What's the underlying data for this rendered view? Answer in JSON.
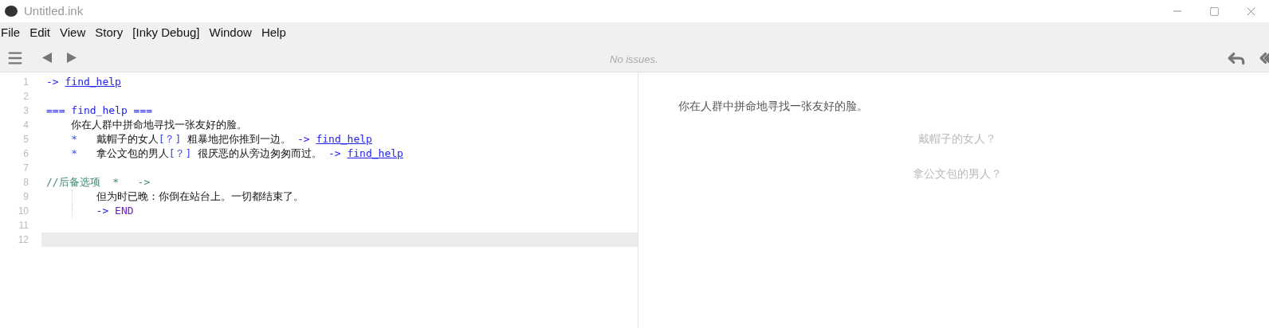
{
  "window": {
    "title": "Untitled.ink"
  },
  "menu": [
    "File",
    "Edit",
    "View",
    "Story",
    "[Inky Debug]",
    "Window",
    "Help"
  ],
  "toolbar": {
    "status": "No issues."
  },
  "editor": {
    "lines": [
      {
        "number": "1",
        "active": false,
        "guide": false,
        "tokens": [
          {
            "kind": "arrow",
            "text": "-> "
          },
          {
            "kind": "link",
            "text": "find_help"
          }
        ]
      },
      {
        "number": "2",
        "active": false,
        "guide": false
      },
      {
        "number": "3",
        "active": false,
        "guide": false,
        "tokens": [
          {
            "kind": "knot",
            "text": "=== find_help ==="
          }
        ]
      },
      {
        "number": "4",
        "active": false,
        "guide": false,
        "tokens": [
          {
            "kind": "plain",
            "text": "    你在人群中拼命地寻找一张友好的脸。"
          }
        ]
      },
      {
        "number": "5",
        "active": false,
        "guide": false,
        "tokens": [
          {
            "kind": "bullet",
            "text": "    *   "
          },
          {
            "kind": "plain",
            "text": "戴帽子的女人"
          },
          {
            "kind": "bracket",
            "text": "[？]"
          },
          {
            "kind": "plain",
            "text": " 粗暴地把你推到一边。 "
          },
          {
            "kind": "arrow",
            "text": "-> "
          },
          {
            "kind": "link",
            "text": "find_help"
          }
        ]
      },
      {
        "number": "6",
        "active": false,
        "guide": false,
        "tokens": [
          {
            "kind": "bullet",
            "text": "    *   "
          },
          {
            "kind": "plain",
            "text": "拿公文包的男人"
          },
          {
            "kind": "bracket",
            "text": "[？]"
          },
          {
            "kind": "plain",
            "text": " 很厌恶的从旁边匆匆而过。 "
          },
          {
            "kind": "arrow",
            "text": "-> "
          },
          {
            "kind": "link",
            "text": "find_help"
          }
        ]
      },
      {
        "number": "7",
        "active": false,
        "guide": false
      },
      {
        "number": "8",
        "active": false,
        "guide": false,
        "tokens": [
          {
            "kind": "comment",
            "text": "//后备选项  *   ->"
          }
        ]
      },
      {
        "number": "9",
        "active": false,
        "guide": true,
        "tokens": [
          {
            "kind": "plain",
            "text": "        但为时已晚：你倒在站台上。一切都结束了。"
          }
        ]
      },
      {
        "number": "10",
        "active": false,
        "guide": true,
        "tokens": [
          {
            "kind": "arrow",
            "text": "        -> "
          },
          {
            "kind": "end",
            "text": "END"
          }
        ]
      },
      {
        "number": "11",
        "active": false,
        "guide": false
      },
      {
        "number": "12",
        "active": true,
        "guide": false
      }
    ]
  },
  "player": {
    "text": "你在人群中拼命地寻找一张友好的脸。",
    "choices": [
      "戴帽子的女人？",
      "拿公文包的男人？"
    ]
  }
}
